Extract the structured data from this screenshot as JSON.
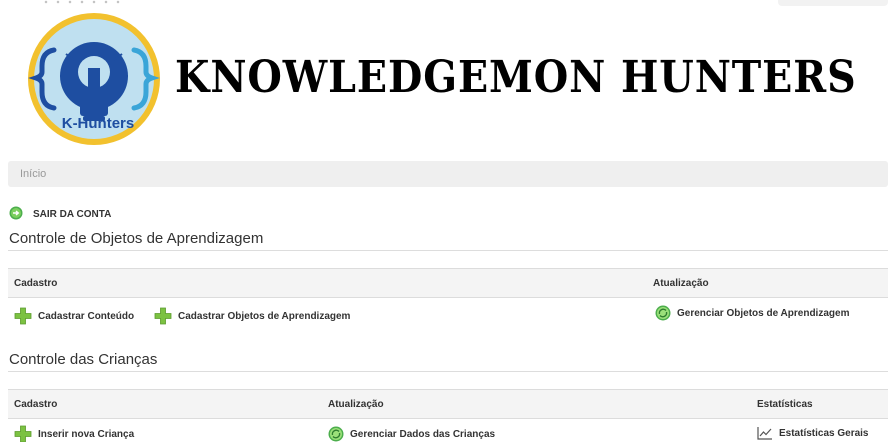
{
  "brand": {
    "logo_text": "K-Hunters",
    "title": "KNOWLEDGEMON HUNTERS"
  },
  "breadcrumb": {
    "home": "Início"
  },
  "logout": {
    "label": "SAIR DA CONTA",
    "icon": "logout-icon"
  },
  "section_objects": {
    "title": "Controle de Objetos de Aprendizagem",
    "columns": [
      "Cadastro",
      "Atualização"
    ],
    "links": {
      "register_content": "Cadastrar Conteúdo",
      "register_objects": "Cadastrar Objetos de Aprendizagem",
      "manage_objects": "Gerenciar Objetos de Aprendizagem"
    }
  },
  "section_children": {
    "title": "Controle das Crianças",
    "columns": [
      "Cadastro",
      "Atualização",
      "Estatísticas"
    ],
    "links": {
      "insert_child": "Inserir nova Criança",
      "manage_children": "Gerenciar Dados das Crianças",
      "general_stats": "Estatísticas Gerais"
    }
  },
  "colors": {
    "plus": "#7cc242",
    "refresh": "#5cb85c",
    "header_bg": "#f4f4f4",
    "logo_blue": "#1e4ea1",
    "logo_gold": "#f2c12e"
  }
}
